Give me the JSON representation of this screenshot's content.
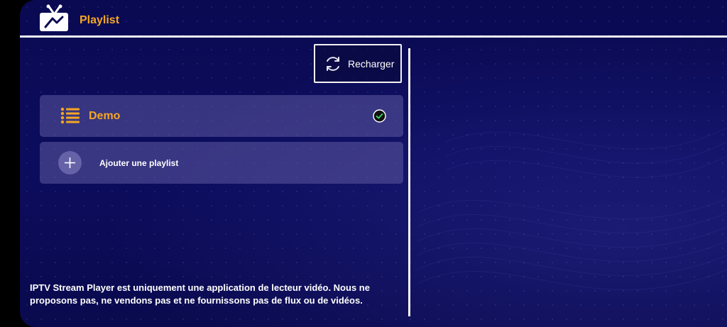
{
  "header": {
    "title": "Playlist",
    "logo_icon": "tv-antenna-icon"
  },
  "toolbar": {
    "reload_label": "Recharger",
    "reload_icon": "refresh-icon"
  },
  "playlists": [
    {
      "label": "Demo",
      "icon": "list-icon",
      "selected": true,
      "status_icon": "check-circle-icon"
    }
  ],
  "add_playlist": {
    "label": "Ajouter une playlist",
    "icon": "plus-icon"
  },
  "disclaimer": "IPTV Stream Player est uniquement une application de lecteur vidéo. Nous ne proposons pas, ne vendons pas et ne fournissons pas de flux ou de vidéos.",
  "colors": {
    "accent": "#f5a623",
    "background": "#0a0a52",
    "check_green": "#3ddc6a"
  }
}
